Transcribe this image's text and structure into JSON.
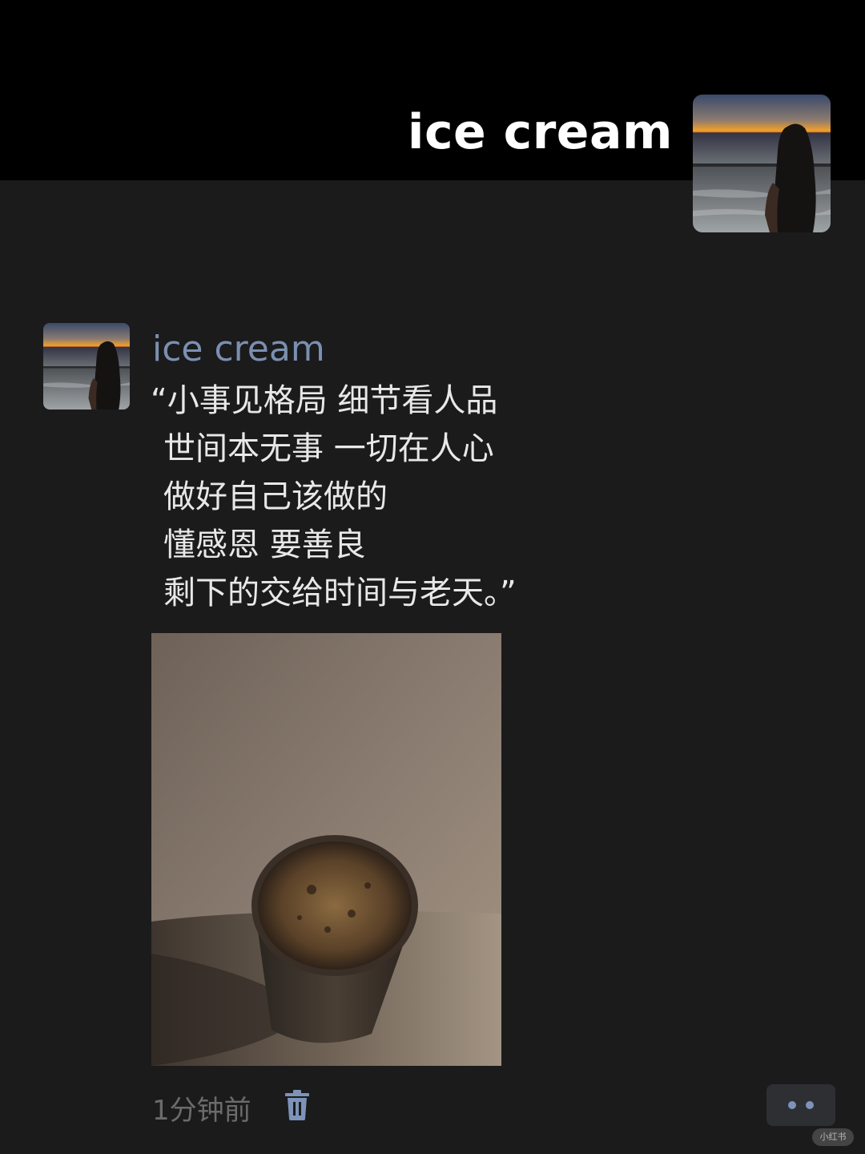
{
  "header": {
    "name": "ice cream",
    "avatar_icon": "sunset-sea-girl-avatar"
  },
  "post": {
    "author": "ice cream",
    "avatar_icon": "sunset-sea-girl-avatar",
    "text_lines": [
      "“小事见格局 细节看人品",
      "世间本无事 一切在人心",
      "做好自己该做的",
      "懂感恩 要善良",
      "剩下的交给时间与老天。”"
    ],
    "photo_icon": "iced-coffee-glass-photo",
    "timestamp": "1分钟前",
    "delete_icon": "trash-icon",
    "more_icon": "more-dots-icon"
  },
  "watermark": {
    "text": "小红书"
  },
  "colors": {
    "background": "#1b1b1c",
    "header_background": "#000000",
    "author_name": "#7b8fb0",
    "body_text": "#e8e8e8",
    "timestamp": "#6b6b6b",
    "accent": "#7d93b8"
  }
}
